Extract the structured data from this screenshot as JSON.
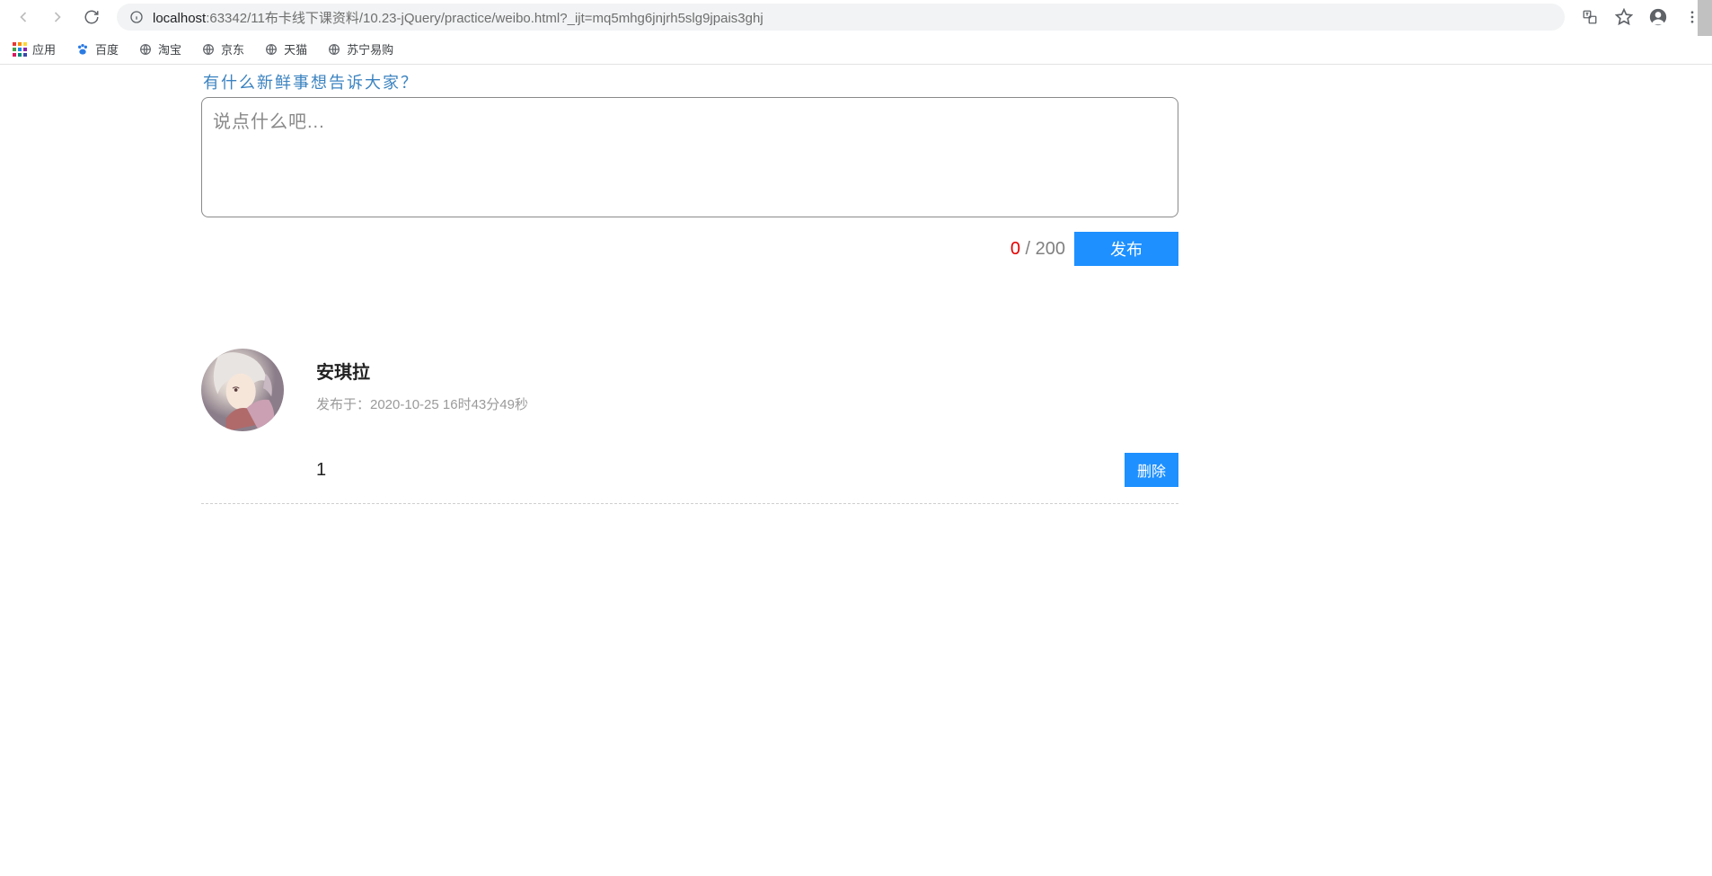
{
  "browser": {
    "url_host": "localhost",
    "url_rest": ":63342/11布卡线下课资料/10.23-jQuery/practice/weibo.html?_ijt=mq5mhg6jnjrh5slg9jpais3ghj",
    "bookmarks": {
      "apps": "应用",
      "baidu": "百度",
      "taobao": "淘宝",
      "jd": "京东",
      "tmall": "天猫",
      "suning": "苏宁易购"
    }
  },
  "composer": {
    "title": "有什么新鲜事想告诉大家？",
    "placeholder": "说点什么吧...",
    "count": "0",
    "max_label": " / 200",
    "publish_label": "发布"
  },
  "post": {
    "name": "安琪拉",
    "time": "发布于：2020-10-25 16时43分49秒",
    "content": "1",
    "delete_label": "删除"
  }
}
